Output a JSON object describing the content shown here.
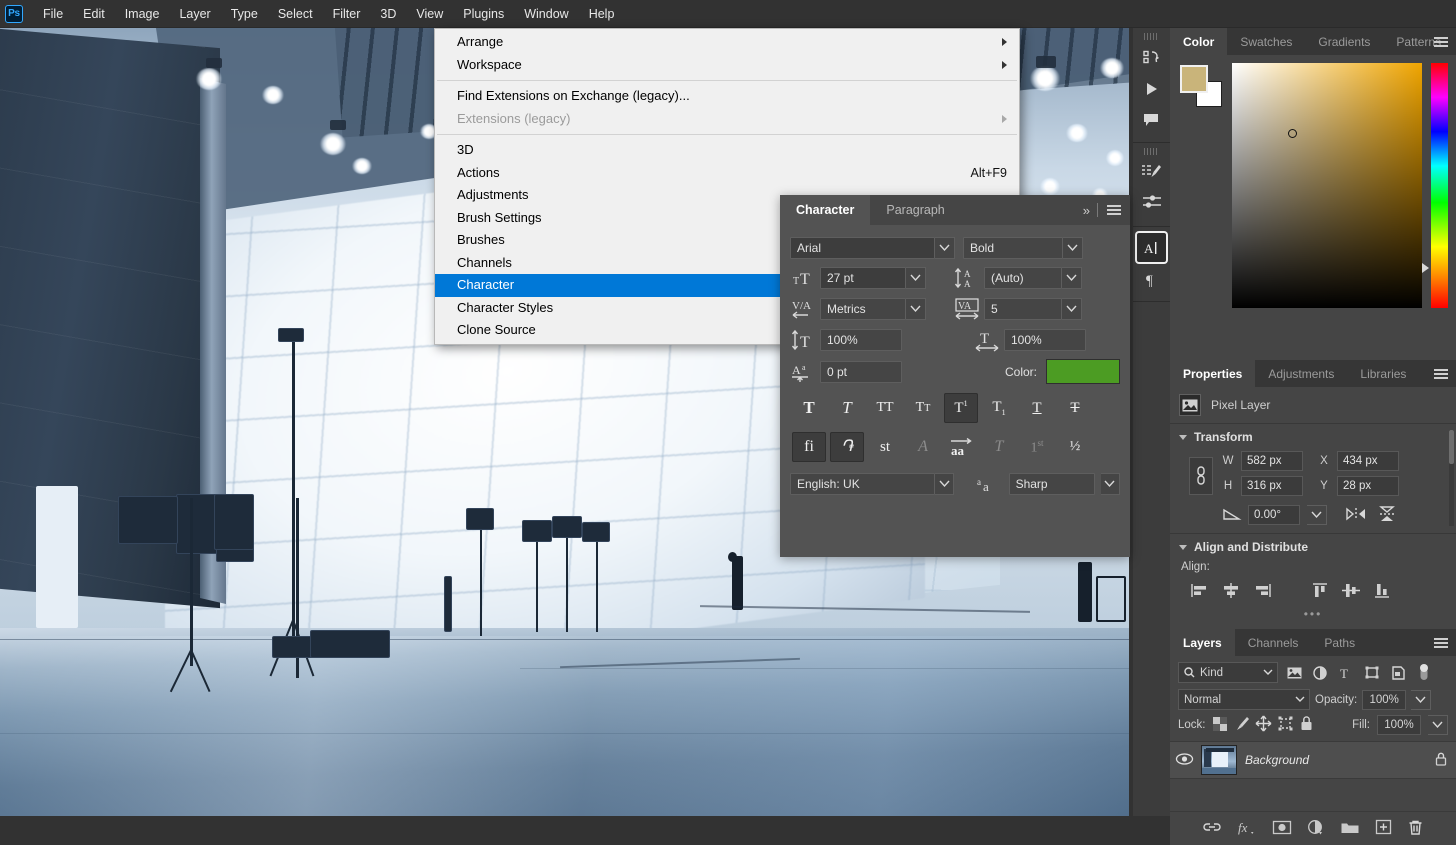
{
  "app": {
    "logo": "Ps"
  },
  "menubar": {
    "items": [
      "File",
      "Edit",
      "Image",
      "Layer",
      "Type",
      "Select",
      "Filter",
      "3D",
      "View",
      "Plugins",
      "Window",
      "Help"
    ]
  },
  "window_menu": {
    "groups": [
      [
        {
          "label": "Arrange",
          "submenu": true,
          "accel": "",
          "disabled": false,
          "selected": false
        },
        {
          "label": "Workspace",
          "submenu": true,
          "accel": "",
          "disabled": false,
          "selected": false
        }
      ],
      [
        {
          "label": "Find Extensions on Exchange (legacy)...",
          "submenu": false,
          "accel": "",
          "disabled": false,
          "selected": false
        },
        {
          "label": "Extensions (legacy)",
          "submenu": true,
          "accel": "",
          "disabled": true,
          "selected": false
        }
      ],
      [
        {
          "label": "3D",
          "submenu": false,
          "accel": "",
          "disabled": false,
          "selected": false
        },
        {
          "label": "Actions",
          "submenu": false,
          "accel": "Alt+F9",
          "disabled": false,
          "selected": false
        },
        {
          "label": "Adjustments",
          "submenu": false,
          "accel": "",
          "disabled": false,
          "selected": false
        },
        {
          "label": "Brush Settings",
          "submenu": false,
          "accel": "",
          "disabled": false,
          "selected": false
        },
        {
          "label": "Brushes",
          "submenu": false,
          "accel": "",
          "disabled": false,
          "selected": false
        },
        {
          "label": "Channels",
          "submenu": false,
          "accel": "",
          "disabled": false,
          "selected": false
        },
        {
          "label": "Character",
          "submenu": false,
          "accel": "",
          "disabled": false,
          "selected": true
        },
        {
          "label": "Character Styles",
          "submenu": false,
          "accel": "",
          "disabled": false,
          "selected": false
        },
        {
          "label": "Clone Source",
          "submenu": false,
          "accel": "",
          "disabled": false,
          "selected": false
        }
      ]
    ]
  },
  "character_panel": {
    "tabs": [
      {
        "label": "Character",
        "active": true
      },
      {
        "label": "Paragraph",
        "active": false
      }
    ],
    "font_family": "Arial",
    "font_style": "Bold",
    "font_size": "27 pt",
    "leading": "(Auto)",
    "kerning": "Metrics",
    "tracking": "5",
    "vertical_scale": "100%",
    "horizontal_scale": "100%",
    "baseline_shift": "0 pt",
    "color_label": "Color:",
    "color_value": "#4c9c23",
    "language": "English: UK",
    "antialias": "Sharp",
    "style_buttons": [
      "faux-bold",
      "faux-italic",
      "all-caps",
      "small-caps",
      "superscript",
      "subscript",
      "underline",
      "strikethrough"
    ],
    "style_active": "superscript",
    "opentype_buttons": [
      "standard-ligatures",
      "discretionary-ligatures",
      "stylistic-set",
      "swash",
      "contextual-alternates",
      "titling-alternates",
      "ordinals",
      "fractions"
    ],
    "opentype_active": [
      "standard-ligatures",
      "discretionary-ligatures"
    ],
    "opentype_disabled": [
      "swash",
      "titling-alternates",
      "ordinals"
    ]
  },
  "icon_rail": {
    "groups": [
      [
        "history-icon",
        "play-icon",
        "comment-icon"
      ],
      [
        "brush-presets-icon",
        "brush-settings-icon"
      ],
      [
        "character-panel-icon",
        "paragraph-panel-icon"
      ]
    ],
    "active": "character-panel-icon"
  },
  "color_panel": {
    "tabs": [
      {
        "label": "Color",
        "active": true
      },
      {
        "label": "Swatches",
        "active": false
      },
      {
        "label": "Gradients",
        "active": false
      },
      {
        "label": "Patterns",
        "active": false
      }
    ],
    "foreground": "#c9b47a",
    "background": "#ffffff",
    "field_base_hue": "#f0a500"
  },
  "properties_panel": {
    "tabs": [
      {
        "label": "Properties",
        "active": true
      },
      {
        "label": "Adjustments",
        "active": false
      },
      {
        "label": "Libraries",
        "active": false
      }
    ],
    "layer_kind": "Pixel Layer",
    "transform": {
      "title": "Transform",
      "w_label": "W",
      "w_value": "582 px",
      "x_label": "X",
      "x_value": "434 px",
      "h_label": "H",
      "h_value": "316 px",
      "y_label": "Y",
      "y_value": "28 px",
      "angle_value": "0.00°"
    },
    "align": {
      "title": "Align and Distribute",
      "label": "Align:"
    }
  },
  "layers_panel": {
    "tabs": [
      {
        "label": "Layers",
        "active": true
      },
      {
        "label": "Channels",
        "active": false
      },
      {
        "label": "Paths",
        "active": false
      }
    ],
    "filter_label": "Kind",
    "blend_mode": "Normal",
    "opacity_label": "Opacity:",
    "opacity_value": "100%",
    "lock_label": "Lock:",
    "fill_label": "Fill:",
    "fill_value": "100%",
    "layers": [
      {
        "name": "Background",
        "visible": true,
        "locked": true
      }
    ],
    "bottom_tools": [
      "link-layers-icon",
      "layer-style-icon",
      "layer-mask-icon",
      "adjustment-layer-icon",
      "new-group-icon",
      "new-layer-icon",
      "delete-layer-icon"
    ]
  }
}
